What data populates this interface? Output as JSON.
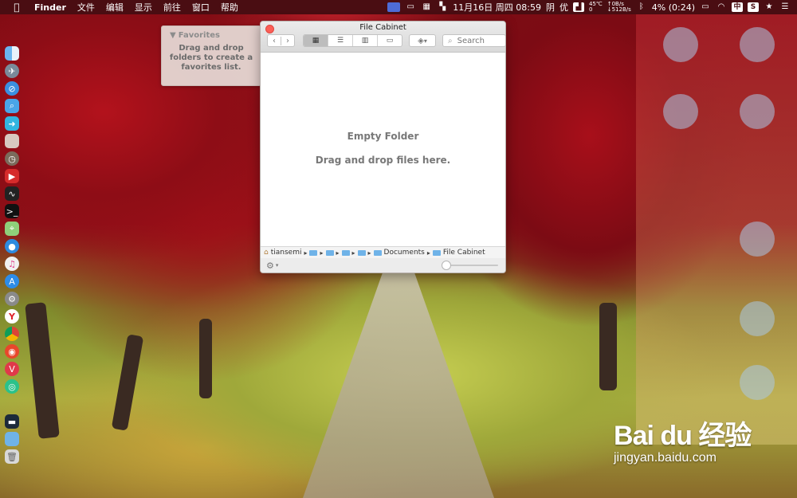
{
  "menubar": {
    "app_name": "Finder",
    "items": [
      "文件",
      "编辑",
      "显示",
      "前往",
      "窗口",
      "帮助"
    ],
    "date_time": "11月16日 周四 08:59",
    "weather": "阴",
    "quality": "优",
    "cpu_temp": "45℃",
    "cpu_extra": "0",
    "net_up": "↑0B/s",
    "net_down": "↓512B/s",
    "battery": "4% (0:24)",
    "input_method": "中"
  },
  "favorites": {
    "header": "Favorites",
    "message": "Drag and drop folders to create a favorites list."
  },
  "window": {
    "title": "File Cabinet",
    "search_placeholder": "Search",
    "empty_title": "Empty Folder",
    "empty_subtitle": "Drag and drop files here.",
    "path": {
      "home": "tiansemi",
      "documents": "Documents",
      "current": "File Cabinet"
    }
  },
  "dock": {
    "icons": [
      "finder-icon",
      "launchpad-icon",
      "safari-icon",
      "preview-icon",
      "messages-icon",
      "photo-icon",
      "clock-icon",
      "video-icon",
      "activity-monitor-icon",
      "terminal-icon",
      "maps-icon",
      "siri-icon",
      "itunes-icon",
      "app-store-icon",
      "system-preferences-icon",
      "yandex-icon",
      "chrome-icon",
      "weibo-icon",
      "vivaldi-icon",
      "wechat-icon",
      "screen-icon",
      "folder-icon",
      "trash-icon"
    ]
  },
  "watermark": {
    "logo": "Bai du 经验",
    "url": "jingyan.baidu.com"
  },
  "colors": {
    "menubar_bg": "#4a0d12",
    "close_button": "#fc5f57",
    "folder_blue": "#6fb3e8"
  }
}
